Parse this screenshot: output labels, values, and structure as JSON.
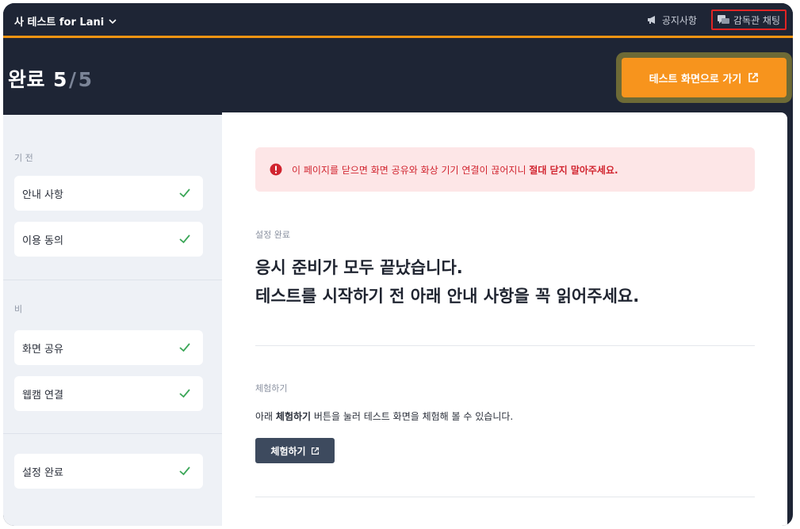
{
  "header": {
    "app_title": "사 테스트  for Lani",
    "notice_label": "공지사항",
    "chat_label": "감독관 채팅"
  },
  "progress": {
    "label": "완료",
    "current": "5",
    "separator": "/",
    "total": "5"
  },
  "cta": {
    "label": "테스트 화면으로 가기"
  },
  "sidebar": {
    "section1_label": "기 전",
    "section2_label": "비",
    "items": [
      {
        "label": "안내 사항"
      },
      {
        "label": "이용 동의"
      },
      {
        "label": "화면 공유"
      },
      {
        "label": "웹캠 연결"
      },
      {
        "label": "설정 완료"
      }
    ]
  },
  "alert": {
    "text_pre": "이 페이지를 닫으면 화면 공유와 화상 기기 연결이 끊어지니 ",
    "text_strong": "절대 닫지 말아주세요."
  },
  "main": {
    "section_label": "설정 완료",
    "headline_line1": "응시 준비가 모두 끝났습니다.",
    "headline_line2": "테스트를 시작하기 전 아래 안내 사항을 꼭 읽어주세요.",
    "trial_label": "체험하기",
    "trial_text_pre": "아래 ",
    "trial_text_bold": "체험하기",
    "trial_text_post": " 버튼을 눌러 테스트 화면을 체험해 볼 수 있습니다.",
    "trial_button": "체험하기"
  },
  "colors": {
    "accent": "#f7941d",
    "dark_bg": "#1e2535",
    "alert_bg": "#fde6e7",
    "alert_text": "#d1242f",
    "check": "#3aa657"
  }
}
